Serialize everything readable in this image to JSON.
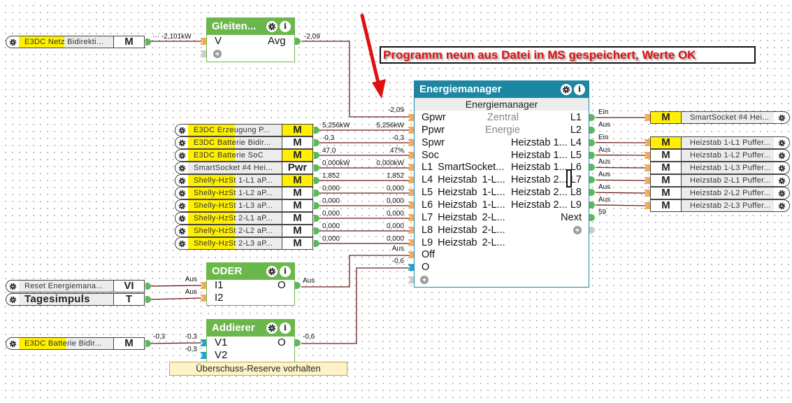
{
  "annotation": "Programm neun aus Datei in MS gespeichert, Werte OK",
  "colors": {
    "green_block": "#6cb74c",
    "teal_block": "#1d86a3",
    "wire": "#6b1f1f",
    "highlight": "#ffef00",
    "pin_in": "#f3a85a",
    "pin_blue": "#1aa3d6",
    "pin_out": "#5cb85c",
    "annotation_text": "#e01010"
  },
  "sources_top": [
    {
      "label": "E3DC Netz Bidirekti...",
      "tag": "M",
      "tag_yellow": false,
      "fill": 0.48
    },
    {
      "label": "Reset Energiemana...",
      "tag": "VI",
      "tag_yellow": false,
      "fill": 0
    },
    {
      "label": "Tagesimpuls",
      "tag": "T",
      "tag_yellow": false,
      "fill": 0,
      "bold": true
    },
    {
      "label": "E3DC Batterie Bidir...",
      "tag": "M",
      "tag_yellow": false,
      "fill": 0.5
    }
  ],
  "sources_left": [
    {
      "label": "E3DC Erzeugung P...",
      "tag": "M",
      "tag_yellow": true,
      "fill": 0.5,
      "out": "5,256kW",
      "in": "5,256kW"
    },
    {
      "label": "E3DC Batterie Bidir...",
      "tag": "M",
      "tag_yellow": false,
      "fill": 0.5,
      "out": "-0,3",
      "in": "-0,3"
    },
    {
      "label": "E3DC Batterie SoC",
      "tag": "M",
      "tag_yellow": true,
      "fill": 0.5,
      "out": "47,0",
      "in": "47%"
    },
    {
      "label": "SmartSocket #4 Hei...",
      "tag": "Pwr",
      "tag_yellow": false,
      "fill": 0,
      "out": "0,000kW",
      "in": "0,000kW"
    },
    {
      "label": "Shelly-HzSt 1-L1 aP...",
      "tag": "M",
      "tag_yellow": true,
      "fill": 0.5,
      "out": "1,852",
      "in": "1,852"
    },
    {
      "label": "Shelly-HzSt 1-L2 aP...",
      "tag": "M",
      "tag_yellow": false,
      "fill": 0.5,
      "out": "0,000",
      "in": "0,000"
    },
    {
      "label": "Shelly-HzSt 1-L3 aP...",
      "tag": "M",
      "tag_yellow": false,
      "fill": 0.5,
      "out": "0,000",
      "in": "0,000"
    },
    {
      "label": "Shelly-HzSt 2-L1 aP...",
      "tag": "M",
      "tag_yellow": false,
      "fill": 0.5,
      "out": "0,000",
      "in": "0,000"
    },
    {
      "label": "Shelly-HzSt 2-L2 aP...",
      "tag": "M",
      "tag_yellow": false,
      "fill": 0.5,
      "out": "0,000",
      "in": "0,000"
    },
    {
      "label": "Shelly-HzSt 2-L3 aP...",
      "tag": "M",
      "tag_yellow": false,
      "fill": 0.5,
      "out": "0,000",
      "in": "0,000"
    }
  ],
  "targets": [
    {
      "label": "SmartSocket #4 Hei...",
      "tag": "M",
      "tag_yellow": true
    },
    {
      "label": "Heizstab 1-L1 Puffer...",
      "tag": "M",
      "tag_yellow": true
    },
    {
      "label": "Heizstab 1-L2 Puffer...",
      "tag": "M",
      "tag_yellow": false
    },
    {
      "label": "Heizstab 1-L3 Puffer...",
      "tag": "M",
      "tag_yellow": false
    },
    {
      "label": "Heizstab 2-L1 Puffer...",
      "tag": "M",
      "tag_yellow": false
    },
    {
      "label": "Heizstab 2-L2 Puffer...",
      "tag": "M",
      "tag_yellow": false
    },
    {
      "label": "Heizstab 2-L3 Puffer...",
      "tag": "M",
      "tag_yellow": false
    }
  ],
  "gleiten": {
    "title": "Gleiten...",
    "inputs": [
      "V"
    ],
    "outputs": [
      "Avg"
    ],
    "in_value": "··· -2,101kW",
    "out_value": "-2,09"
  },
  "oder": {
    "title": "ODER",
    "inputs": [
      "I1",
      "I2"
    ],
    "outputs": [
      "O"
    ],
    "in_values": [
      "Aus",
      "Aus"
    ],
    "out_value": "Aus"
  },
  "addierer": {
    "title": "Addierer",
    "inputs": [
      "V1",
      "V2"
    ],
    "outputs": [
      "O"
    ],
    "in_values": [
      "-0,3",
      "-0,3"
    ],
    "src_value": "-0,3",
    "out_value": "-0,6",
    "comment": "Überschuss-Reserve vorhalten"
  },
  "energiemanager": {
    "title": "Energiemanager",
    "subtitle": "Energiemanager",
    "center_labels": [
      "Zentral",
      "Energie"
    ],
    "inputs": [
      "Gpwr",
      "Ppwr",
      "Spwr",
      "Soc",
      "L1  SmartSocket...",
      "L4  Heizstab  1-L...",
      "L5  Heizstab  1-L...",
      "L6  Heizstab  1-L...",
      "L7  Heizstab  2-L...",
      "L8  Heizstab  2-L...",
      "L9  Heizstab  2-L...",
      "Off",
      "O"
    ],
    "input_values": {
      "Gpwr": "-2,09",
      "Off": "Aus",
      "O": "-0,6"
    },
    "outputs": [
      {
        "pin": "L1",
        "name": "",
        "value": "Ein"
      },
      {
        "pin": "L2",
        "name": "",
        "value": "Aus"
      },
      {
        "pin": "L4",
        "name": "Heizstab 1...",
        "value": "Ein"
      },
      {
        "pin": "L5",
        "name": "Heizstab 1...",
        "value": "Aus"
      },
      {
        "pin": "L6",
        "name": "Heizstab 1...",
        "value": "Aus"
      },
      {
        "pin": "L7",
        "name": "Heizstab 2...",
        "value": "Aus"
      },
      {
        "pin": "L8",
        "name": "Heizstab 2...",
        "value": "Aus"
      },
      {
        "pin": "L9",
        "name": "Heizstab 2...",
        "value": "Aus"
      },
      {
        "pin": "Next",
        "name": "",
        "value": "59"
      }
    ]
  }
}
